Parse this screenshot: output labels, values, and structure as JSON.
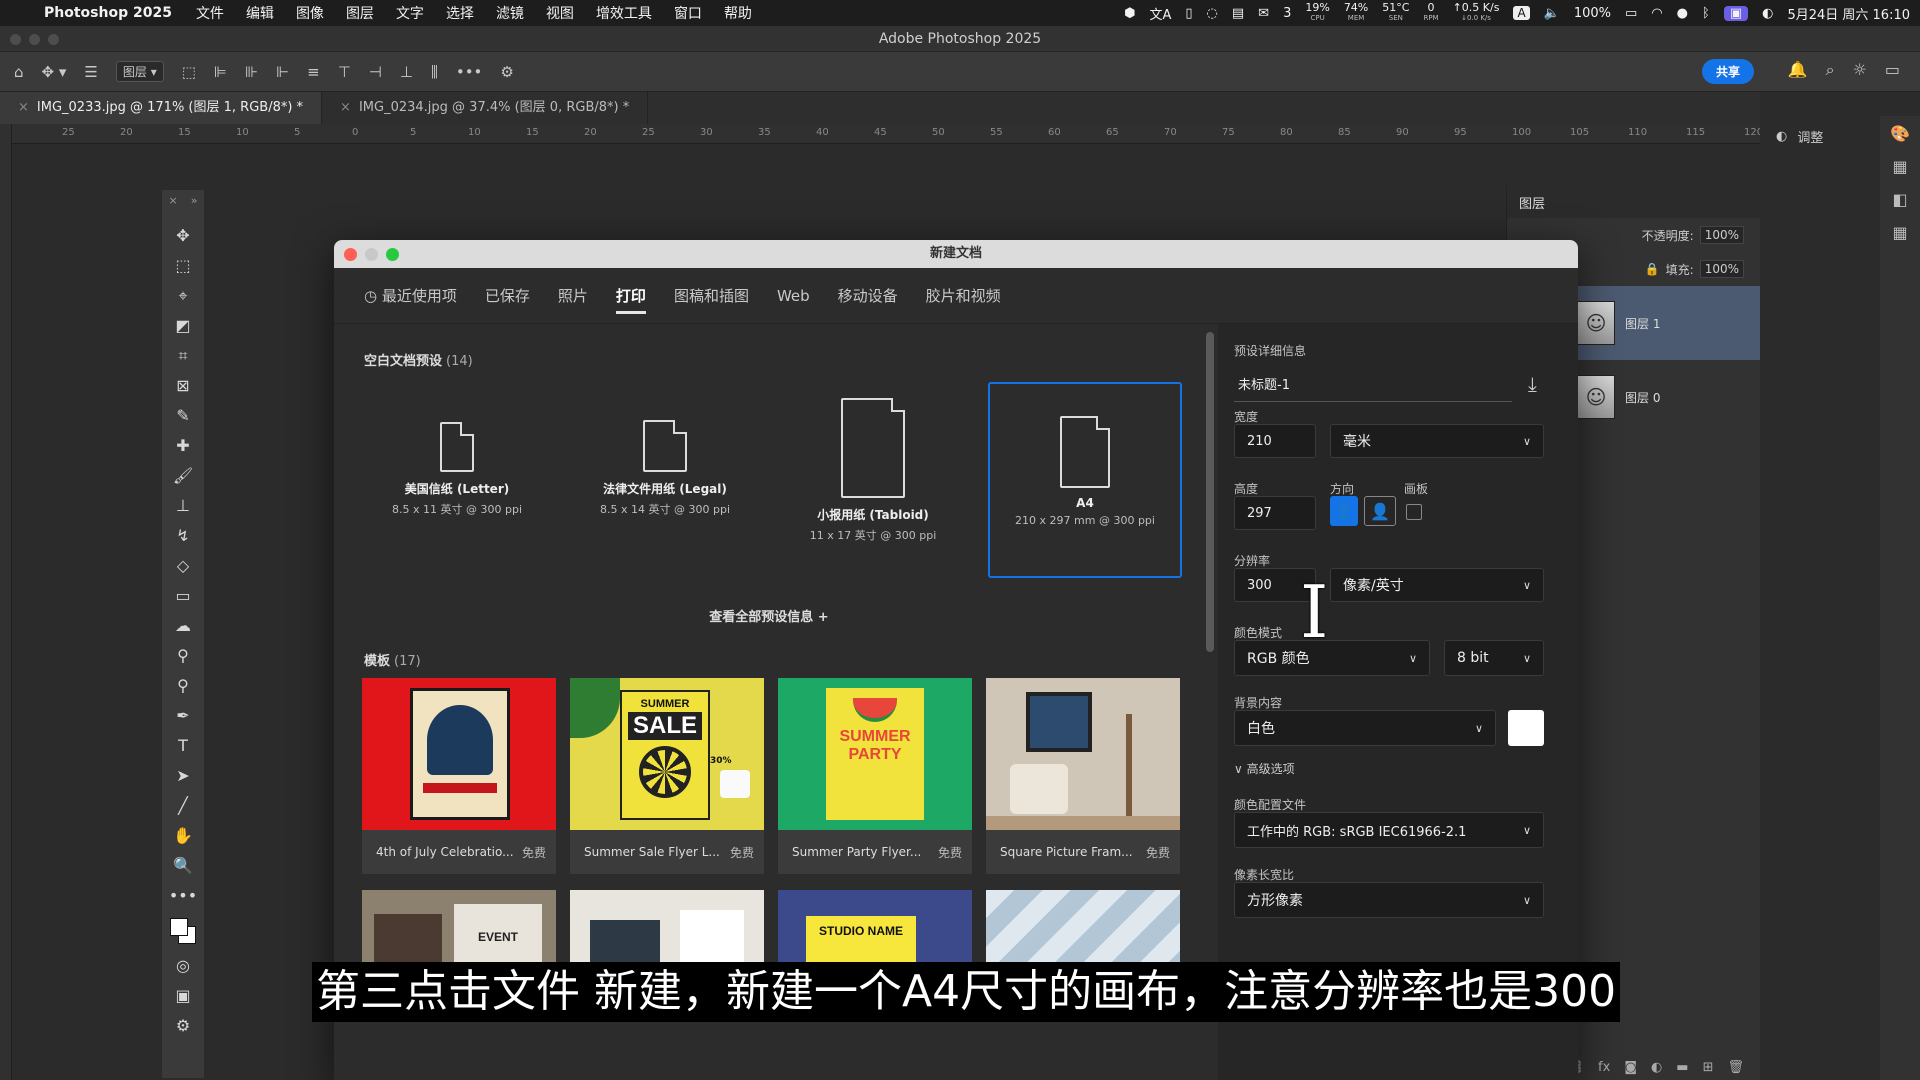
{
  "menubar": {
    "app": "Photoshop 2025",
    "items": [
      "文件",
      "编辑",
      "图像",
      "图层",
      "文字",
      "选择",
      "滤镜",
      "视图",
      "增效工具",
      "窗口",
      "帮助"
    ],
    "wechat_count": "3",
    "stats": [
      {
        "value": "19%",
        "label": "CPU"
      },
      {
        "value": "74%",
        "label": "MEM"
      },
      {
        "value": "51°C",
        "label": "SEN"
      },
      {
        "value": "0",
        "label": "RPM"
      },
      {
        "value": "↑0.5 K/s",
        "label": "↓0.0 K/s"
      }
    ],
    "input_source": "A",
    "battery": "100%",
    "datetime": "5月24日 周六 16:10"
  },
  "window": {
    "title": "Adobe Photoshop 2025"
  },
  "optionsbar": {
    "layer_select": "图层",
    "share_label": "共享"
  },
  "doc_tabs": [
    {
      "label": "IMG_0233.jpg @ 171% (图层 1, RGB/8*) *",
      "active": true
    },
    {
      "label": "IMG_0234.jpg @ 37.4% (图层 0, RGB/8*) *",
      "active": false
    }
  ],
  "ruler_ticks": [
    "25",
    "20",
    "15",
    "10",
    "5",
    "0",
    "5",
    "10",
    "15",
    "20",
    "25",
    "30",
    "35",
    "40",
    "45",
    "50",
    "55",
    "60",
    "65",
    "70",
    "75",
    "80",
    "85",
    "90",
    "95",
    "100",
    "105",
    "110",
    "115",
    "120"
  ],
  "adjust_panel": {
    "label": "调整"
  },
  "layers_panel": {
    "tab": "图层",
    "opacity_label": "不透明度:",
    "opacity_value": "100%",
    "fill_label": "填充:",
    "fill_value": "100%",
    "layers": [
      {
        "name": "图层 1",
        "selected": true
      },
      {
        "name": "图层 0",
        "selected": false
      }
    ]
  },
  "dialog": {
    "title": "新建文档",
    "tabs": [
      "最近使用项",
      "已保存",
      "照片",
      "打印",
      "图稿和插图",
      "Web",
      "移动设备",
      "胶片和视频"
    ],
    "active_tab": "打印",
    "blank_presets_label": "空白文档预设",
    "blank_presets_count": "(14)",
    "presets": [
      {
        "name": "美国信纸 (Letter)",
        "spec": "8.5 x 11 英寸 @ 300 ppi"
      },
      {
        "name": "法律文件用纸 (Legal)",
        "spec": "8.5 x 14 英寸 @ 300 ppi"
      },
      {
        "name": "小报用纸 (Tabloid)",
        "spec": "11 x 17 英寸 @ 300 ppi"
      },
      {
        "name": "A4",
        "spec": "210 x 297 mm @ 300 ppi"
      }
    ],
    "view_all": "查看全部预设信息 +",
    "templates_label": "模板",
    "templates_count": "(17)",
    "templates": [
      {
        "name": "4th of July Celebratio...",
        "badge": "免费"
      },
      {
        "name": "Summer Sale Flyer L...",
        "badge": "免费"
      },
      {
        "name": "Summer Party Flyer...",
        "badge": "免费"
      },
      {
        "name": "Square Picture Fram...",
        "badge": "免费"
      }
    ],
    "template_texts": {
      "summer_sale_1": "SUMMER",
      "summer_sale_2": "SALE",
      "summer_sale_pct": "30%",
      "party_1": "SUMMER",
      "party_2": "PARTY",
      "event": "EVENT",
      "studio": "STUDIO NAME"
    },
    "details": {
      "header": "预设详细信息",
      "doc_name": "未标题-1",
      "width_label": "宽度",
      "width_value": "210",
      "unit": "毫米",
      "height_label": "高度",
      "height_value": "297",
      "orientation_label": "方向",
      "artboard_label": "画板",
      "resolution_label": "分辨率",
      "resolution_value": "300",
      "resolution_unit": "像素/英寸",
      "color_mode_label": "颜色模式",
      "color_mode": "RGB 颜色",
      "bit_depth": "8 bit",
      "bg_label": "背景内容",
      "bg_value": "白色",
      "advanced": "高级选项",
      "profile_label": "颜色配置文件",
      "profile_value": "工作中的 RGB: sRGB IEC61966-2.1",
      "pixel_aspect_label": "像素长宽比",
      "pixel_aspect_value": "方形像素"
    }
  },
  "subtitle": "第三点击文件 新建，新建一个A4尺寸的画布，注意分辨率也是300"
}
